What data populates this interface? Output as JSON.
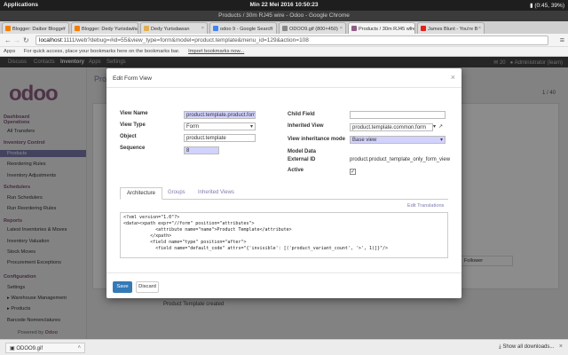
{
  "os": {
    "app_menu": "Applications",
    "datetime": "Min 22 Mei 2016     10:50:23",
    "status": "(0:45, 39%)"
  },
  "window": {
    "title": "Products / 30m RJ45 wire - Odoo - Google Chrome"
  },
  "tabs": [
    {
      "label": "Blogger: Daibor Blogger",
      "color": "#f57d00"
    },
    {
      "label": "Blogger: Dedy Yurisdawan",
      "color": "#f57d00"
    },
    {
      "label": "Dedy Yurisdawan",
      "color": "#e0b050"
    },
    {
      "label": "odoo 9 - Google Search",
      "color": "#4285f4"
    },
    {
      "label": "ODOO9.gif (800×450)",
      "color": "#888888"
    },
    {
      "label": "Products / 30m RJ45 wire",
      "color": "#8f5d85"
    },
    {
      "label": "James Blunt - You're B",
      "color": "#e62117"
    }
  ],
  "address": {
    "url_host": "localhost",
    "url_rest": ":1111/web?debug=#id=55&view_type=form&model=product.template&menu_id=129&action=108"
  },
  "bookmarks": {
    "apps": "Apps",
    "hint": "For quick access, place your bookmarks here on the bookmarks bar.",
    "import": "Import bookmarks now..."
  },
  "odoo_menu": {
    "items": [
      "Discuss",
      "Contacts",
      "Inventory",
      "Apps",
      "Settings"
    ],
    "active": "Inventory",
    "notif": "20",
    "user": "Administrator (learn)"
  },
  "sidebar": {
    "logo": "odoo",
    "items": [
      {
        "label": "Dashboard",
        "kind": "h"
      },
      {
        "label": "Operations",
        "kind": "h"
      },
      {
        "label": "All Transfers",
        "kind": "sub"
      },
      {
        "label": "Inventory Control",
        "kind": "h"
      },
      {
        "label": "Products",
        "kind": "sel"
      },
      {
        "label": "Reordering Rules",
        "kind": "sub"
      },
      {
        "label": "Inventory Adjustments",
        "kind": "sub"
      },
      {
        "label": "Schedulers",
        "kind": "h"
      },
      {
        "label": "Run Schedulers",
        "kind": "sub"
      },
      {
        "label": "Run Reordering Rules",
        "kind": "sub"
      },
      {
        "label": "Reports",
        "kind": "h"
      },
      {
        "label": "Latest Inventories & Moves",
        "kind": "sub"
      },
      {
        "label": "Inventory Valuation",
        "kind": "sub"
      },
      {
        "label": "Stock Moves",
        "kind": "sub"
      },
      {
        "label": "Procurement Exceptions",
        "kind": "sub"
      },
      {
        "label": "Configuration",
        "kind": "h"
      },
      {
        "label": "Settings",
        "kind": "sub"
      },
      {
        "label": "▸ Warehouse Management",
        "kind": "sub"
      },
      {
        "label": "▸ Products",
        "kind": "sub"
      },
      {
        "label": "Barcode Nomenclatures",
        "kind": "sub"
      }
    ],
    "powered": "Powered by ",
    "powered_brand": "Odoo"
  },
  "page": {
    "crumb": "Produ",
    "pager": "1 / 40",
    "chatter": "Product Template created",
    "follower": "Follower"
  },
  "modal": {
    "title": "Edit Form View",
    "close": "×",
    "fields": {
      "view_name_label": "View Name",
      "view_name": "product.template.product.form",
      "view_type_label": "View Type",
      "view_type": "Form",
      "object_label": "Object",
      "object": "product.template",
      "sequence_label": "Sequence",
      "sequence": "8",
      "child_field_label": "Child Field",
      "child_field": "",
      "inherited_view_label": "Inherited View",
      "inherited_view": "product.template.common.form",
      "inheritance_mode_label": "View inheritance mode",
      "inheritance_mode": "Base view",
      "model_data_label": "Model Data",
      "external_id_label": "External ID",
      "external_id": "product.product_template_only_form_view",
      "active_label": "Active",
      "active": true
    },
    "tabs": [
      "Architecture",
      "Groups",
      "Inherited Views"
    ],
    "edit_translations": "Edit Translations",
    "code": [
      "<?xml version=\"1.0\"?>",
      "<data><xpath expr=\"//form\" position=\"attributes\">",
      "            <attribute name=\"name\">Product Template</attribute>",
      "          </xpath>",
      "          <field name=\"type\" position=\"after\">",
      "            <field name=\"default_code\" attrs=\"{'invisible': [('product_variant_count', '>', 1)]}\"/>"
    ],
    "save": "Save",
    "discard": "Discard"
  },
  "downloads": {
    "file": "ODOO9.gif",
    "show_all": "Show all downloads...",
    "close": "×"
  }
}
